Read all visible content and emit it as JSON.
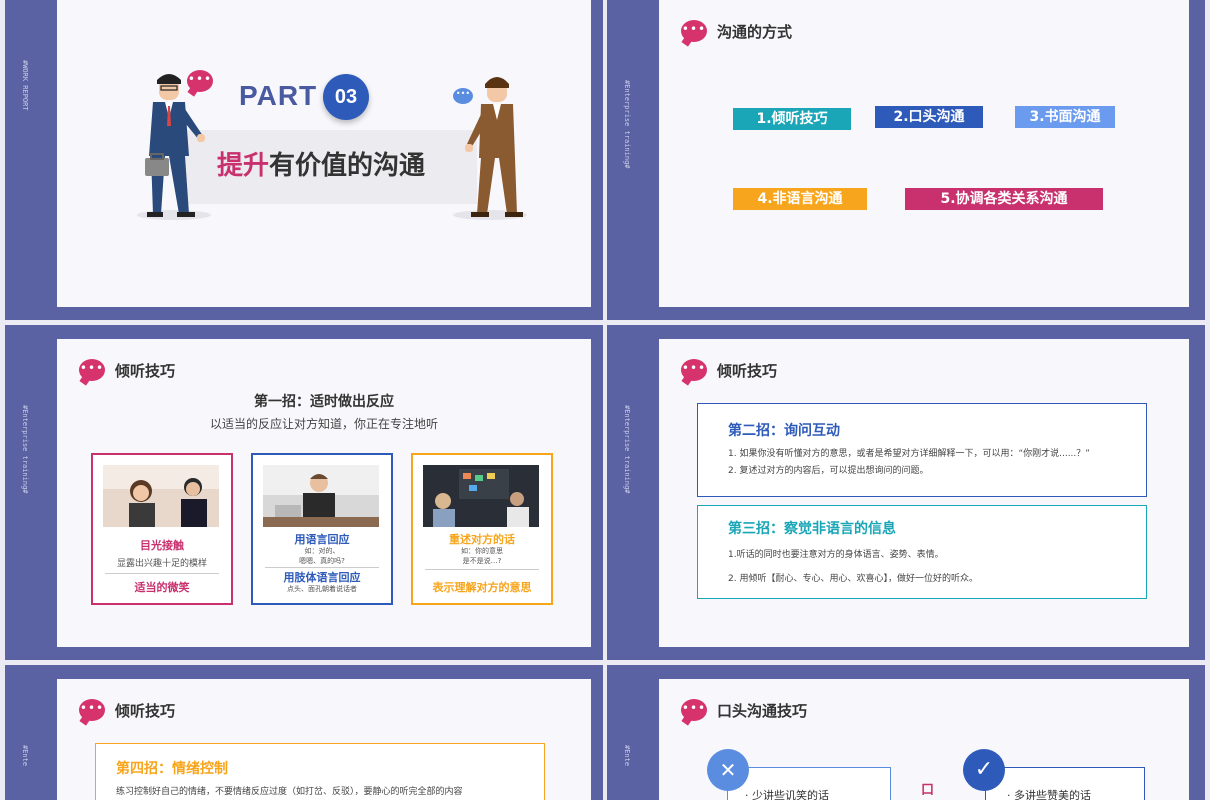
{
  "slide1": {
    "side_text": "#WORK  REPORT",
    "part_label": "PART",
    "part_number": "03",
    "title_accent": "提升",
    "title_rest": "有价值的沟通"
  },
  "slide2": {
    "side_text": "#Enterprise training#",
    "section_title": "沟通的方式",
    "methods": [
      {
        "label": "1.倾听技巧",
        "color": "#1aa6b7"
      },
      {
        "label": "2.口头沟通",
        "color": "#2e5bba"
      },
      {
        "label": "3.书面沟通",
        "color": "#6b9bef"
      },
      {
        "label": "4.非语言沟通",
        "color": "#f7a51c"
      },
      {
        "label": "5.协调各类关系沟通",
        "color": "#c8306e"
      }
    ]
  },
  "slide3": {
    "side_text": "#Enterprise training#",
    "section_title": "倾听技巧",
    "heading": "第一招：适时做出反应",
    "subheading": "以适当的反应让对方知道，你正在专注地听",
    "cards": [
      {
        "color": "#c8306e",
        "title": "目光接触",
        "desc": "显露出兴趣十足的模样",
        "title2": "适当的微笑"
      },
      {
        "color": "#2e5bba",
        "title": "用语言回应",
        "desc": "如：对的、\n嗯嗯、真的吗?",
        "title2": "用肢体语言回应",
        "desc2": "点头、面孔朝着说话者"
      },
      {
        "color": "#f7a51c",
        "title": "重述对方的话",
        "desc": "如：你的意思\n是不是说…?",
        "title2": "表示理解对方的意思"
      }
    ]
  },
  "slide4": {
    "side_text": "#Enterprise training#",
    "section_title": "倾听技巧",
    "box1": {
      "title": "第二招：询问互动",
      "line1": "1. 如果你没有听懂对方的意思，或者是希望对方详细解释一下，可以用：“你刚才说......？”",
      "line2": "2. 复述过对方的内容后，可以提出想询问的问题。"
    },
    "box2": {
      "title": "第三招：察觉非语言的信息",
      "line1": "1.听话的同时也要注意对方的身体语言、姿势、表情。",
      "line2": "2. 用倾听【耐心、专心、用心、欢喜心】，做好一位好的听众。"
    }
  },
  "slide5": {
    "side_text": "#Ente",
    "section_title": "倾听技巧",
    "box": {
      "title": "第四招：情绪控制",
      "line1": "练习控制好自己的情绪，不要情绪反应过度（如打岔、反驳），要静心的听完全部的内容"
    }
  },
  "slide6": {
    "side_text": "#Ente",
    "section_title": "口头沟通技巧",
    "left_item": "· 少讲些讥笑的话",
    "right_item": "· 多讲些赞美的话",
    "center_char": "口"
  },
  "colors": {
    "frame": "#5b62a4",
    "accent_pink": "#c8306e",
    "accent_blue": "#2e5bba",
    "accent_teal": "#1aa6b7",
    "accent_orange": "#f7a51c"
  }
}
